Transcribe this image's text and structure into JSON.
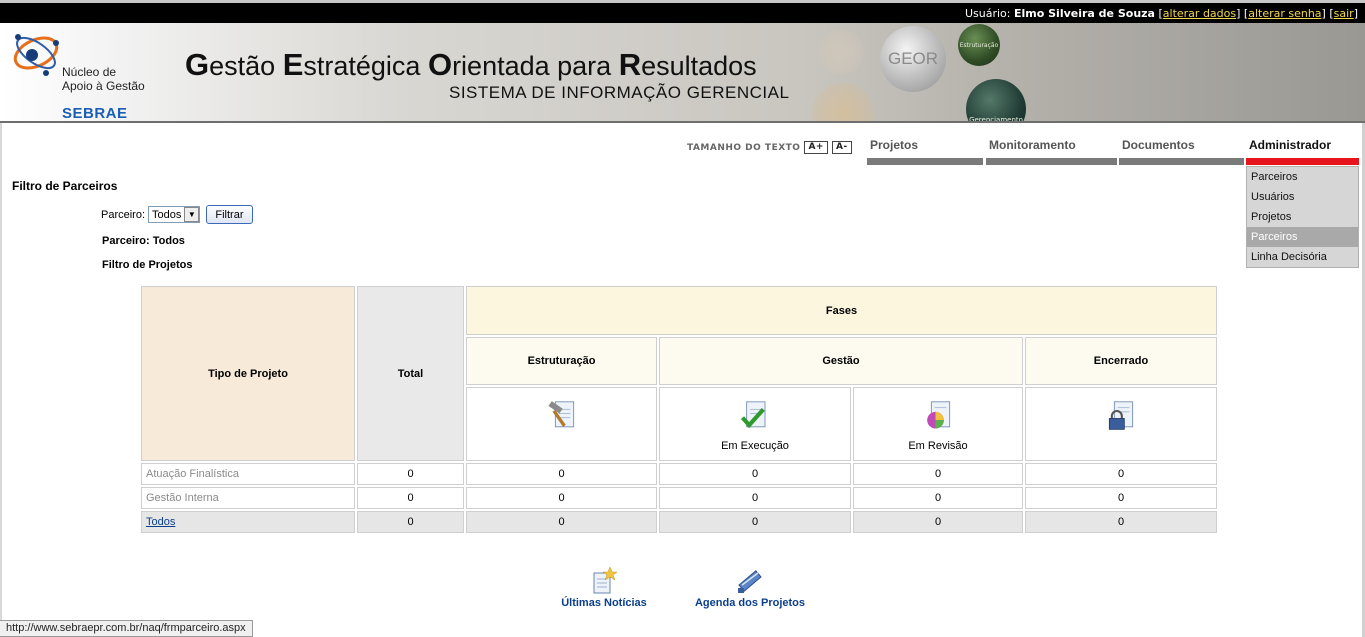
{
  "userbar": {
    "label": "Usuário:",
    "user_name": "Elmo Silveira de Souza",
    "links": [
      "alterar dados",
      "alterar senha",
      "sair"
    ]
  },
  "banner": {
    "logo_line1": "Núcleo de",
    "logo_line2": "Apoio à Gestão",
    "logo_brand": "SEBRAE",
    "title_words": [
      {
        "cap": "G",
        "rest": "estão "
      },
      {
        "cap": "E",
        "rest": "stratégica "
      },
      {
        "cap": "O",
        "rest": "rientada para "
      },
      {
        "cap": "R",
        "rest": "esultados"
      }
    ],
    "subtitle": "SISTEMA DE INFORMAÇÃO GERENCIAL",
    "orb_geor": "GEOR",
    "orb_estruturacao": "Estruturação",
    "orb_gerenciamento": "Gerenciamento"
  },
  "text_size": {
    "label": "TAMANHO DO TEXTO",
    "increase": "A+",
    "decrease": "A-"
  },
  "nav": {
    "tabs": [
      "Projetos",
      "Monitoramento",
      "Documentos",
      "Administrador"
    ],
    "admin_menu": [
      "Parceiros",
      "Usuários",
      "Projetos",
      "Parceiros",
      "Linha Decisória"
    ],
    "admin_menu_selected_index": 3
  },
  "filter": {
    "title": "Filtro de Parceiros",
    "parceiro_label": "Parceiro:",
    "parceiro_value": "Todos",
    "button": "Filtrar",
    "current": "Parceiro: Todos",
    "projects_filter": "Filtro de Projetos"
  },
  "table": {
    "col_tipo": "Tipo de Projeto",
    "col_total": "Total",
    "col_fases": "Fases",
    "phases": [
      "Estruturação",
      "Gestão",
      "Encerrado"
    ],
    "sub_captions": [
      "",
      "Em Execução",
      "Em Revisão",
      ""
    ],
    "rows": [
      {
        "name": "Atuação Finalística",
        "values": [
          "0",
          "0",
          "0",
          "0",
          "0"
        ]
      },
      {
        "name": "Gestão Interna",
        "values": [
          "0",
          "0",
          "0",
          "0",
          "0"
        ]
      },
      {
        "name": "Todos",
        "values": [
          "0",
          "0",
          "0",
          "0",
          "0"
        ]
      }
    ]
  },
  "bottom_links": [
    "Últimas Notícias",
    "Agenda dos Projetos"
  ],
  "status_url": "http://www.sebraepr.com.br/naq/frmparceiro.aspx"
}
